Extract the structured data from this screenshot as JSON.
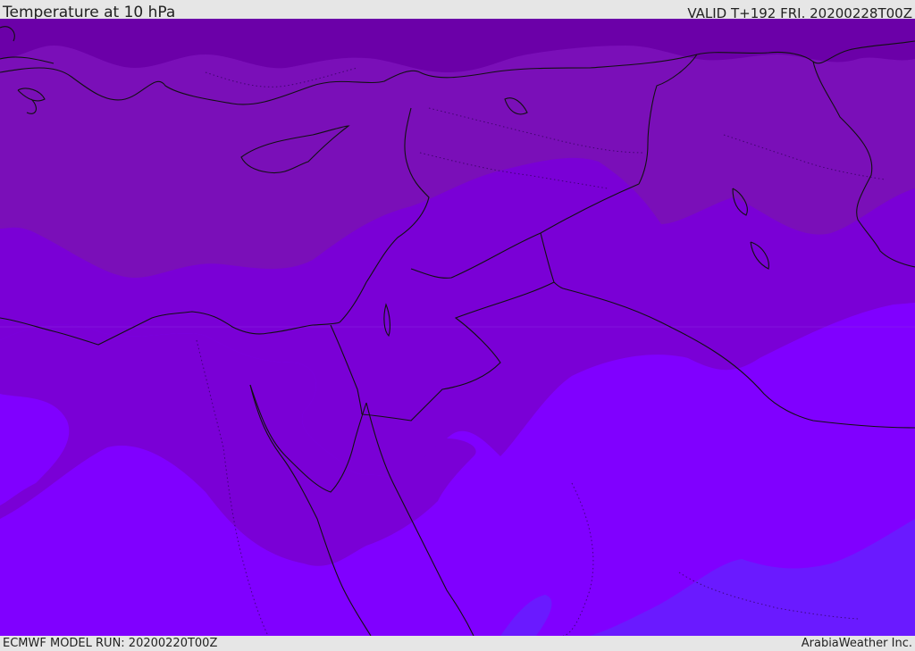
{
  "header": {
    "title": "Temperature at 10 hPa",
    "valid": "VALID T+192 FRI. 20200228T00Z"
  },
  "footer": {
    "model_run": "ECMWF MODEL RUN: 20200220T00Z",
    "credit": "ArabiaWeather Inc."
  },
  "map": {
    "colors": {
      "band_darkest": "#6b00a8",
      "band_dark": "#7a0fb8",
      "band_mid": "#7a00d6",
      "band_light": "#8000ff",
      "band_blue": "#6a1aff",
      "coastline": "#111111"
    }
  }
}
